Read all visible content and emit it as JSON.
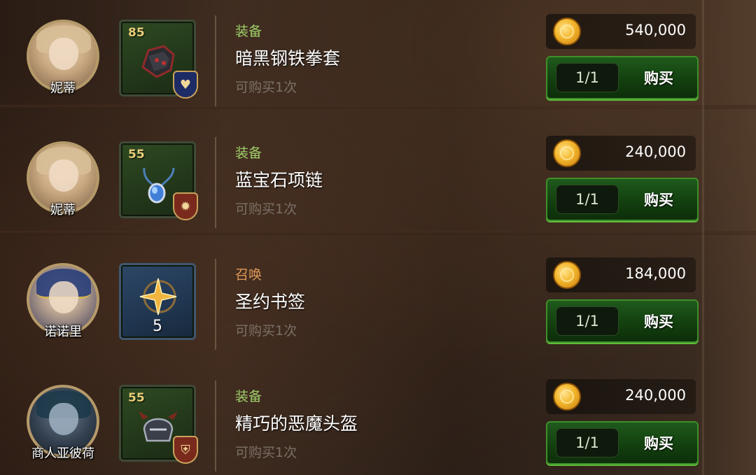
{
  "shop": {
    "items": [
      {
        "npc": "妮蒂",
        "level": "85",
        "category": "装备",
        "category_type": "equip",
        "name": "暗黑钢铁拳套",
        "limit": "可购买1次",
        "price": "540,000",
        "stock": "1/1",
        "buy_label": "购买",
        "icon": "gauntlet-icon",
        "slot_icon": "heart-icon"
      },
      {
        "npc": "妮蒂",
        "level": "55",
        "category": "装备",
        "category_type": "equip",
        "name": "蓝宝石项链",
        "limit": "可购买1次",
        "price": "240,000",
        "stock": "1/1",
        "buy_label": "购买",
        "icon": "necklace-icon",
        "slot_icon": "gear-icon"
      },
      {
        "npc": "诺诺里",
        "count": "5",
        "category": "召唤",
        "category_type": "summon",
        "name": "圣约书签",
        "limit": "可购买1次",
        "price": "184,000",
        "stock": "1/1",
        "buy_label": "购买",
        "icon": "bookmark-star-icon"
      },
      {
        "npc": "商人亚彼荷",
        "level": "55",
        "category": "装备",
        "category_type": "equip",
        "name": "精巧的恶魔头盔",
        "limit": "可购买1次",
        "price": "240,000",
        "stock": "1/1",
        "buy_label": "购买",
        "icon": "helmet-icon",
        "slot_icon": "shield-icon"
      }
    ]
  },
  "colors": {
    "equip_category": "#9fcf6a",
    "summon_category": "#e19a58",
    "buy_button": "#1f5a1c",
    "coin": "#f3b62c"
  }
}
